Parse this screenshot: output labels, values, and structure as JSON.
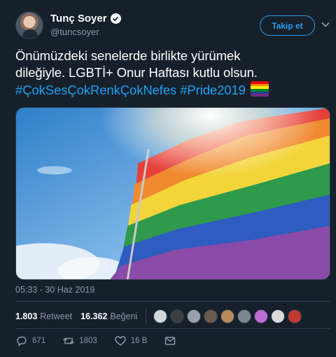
{
  "user": {
    "name": "Tunç Soyer",
    "handle": "@tuncsoyer",
    "follow_label": "Takip et"
  },
  "tweet": {
    "text_line1": "Önümüzdeki senelerde birlikte yürümek",
    "text_line2": "dileğiyle. LGBTİ+ Onur Haftası kutlu olsun.",
    "hashtag1": "#ÇokSesÇokRenkÇokNefes",
    "hashtag2": "#Pride2019",
    "timestamp": "05:33 - 30 Haz 2019"
  },
  "stats": {
    "retweets": "1.803",
    "retweets_label": "Retweet",
    "likes": "16.362",
    "likes_label": "Beğeni"
  },
  "actions": {
    "replies": "671",
    "retweets": "1803",
    "likes": "16 B"
  },
  "colors": {
    "background": "#15202b",
    "accent": "#1da1f2",
    "muted": "#8899a6"
  },
  "icons": [
    "verified-icon",
    "chevron-down-icon",
    "reply-icon",
    "retweet-icon",
    "like-icon",
    "message-icon",
    "rainbow-flag-icon"
  ]
}
